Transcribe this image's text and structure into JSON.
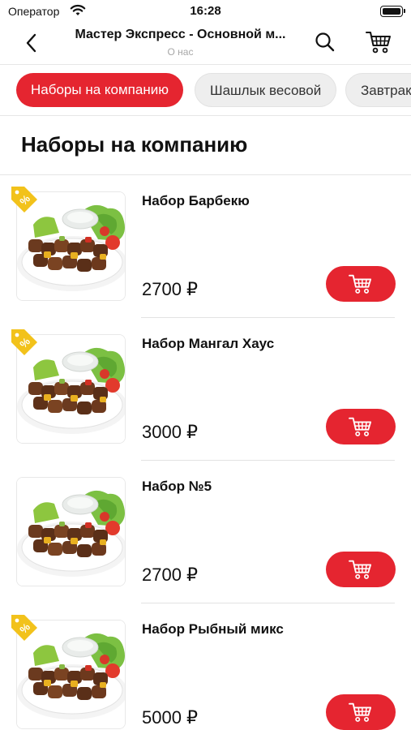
{
  "status_bar": {
    "carrier": "Оператор",
    "time": "16:28"
  },
  "nav": {
    "title": "Мастер Экспресс - Основной м...",
    "subtitle": "О нас"
  },
  "categories": [
    {
      "label": "Наборы на компанию",
      "active": true
    },
    {
      "label": "Шашлык весовой",
      "active": false
    },
    {
      "label": "Завтрак",
      "active": false
    }
  ],
  "section": {
    "title": "Наборы на компанию"
  },
  "products": [
    {
      "name": "Набор Барбекю",
      "price": "2700 ₽",
      "discount_badge": true
    },
    {
      "name": "Набор Мангал Хаус",
      "price": "3000 ₽",
      "discount_badge": true
    },
    {
      "name": "Набор №5",
      "price": "2700 ₽",
      "discount_badge": false
    },
    {
      "name": "Набор Рыбный микс",
      "price": "5000 ₽",
      "discount_badge": true
    }
  ],
  "colors": {
    "accent": "#e52530",
    "badge": "#f2c21b",
    "chip_inactive": "#eeeeee"
  },
  "icons": {
    "back": "chevron-left-icon",
    "search": "search-icon",
    "cart": "shopping-cart-icon",
    "badge": "discount-tag-icon",
    "add": "add-to-cart-icon"
  }
}
